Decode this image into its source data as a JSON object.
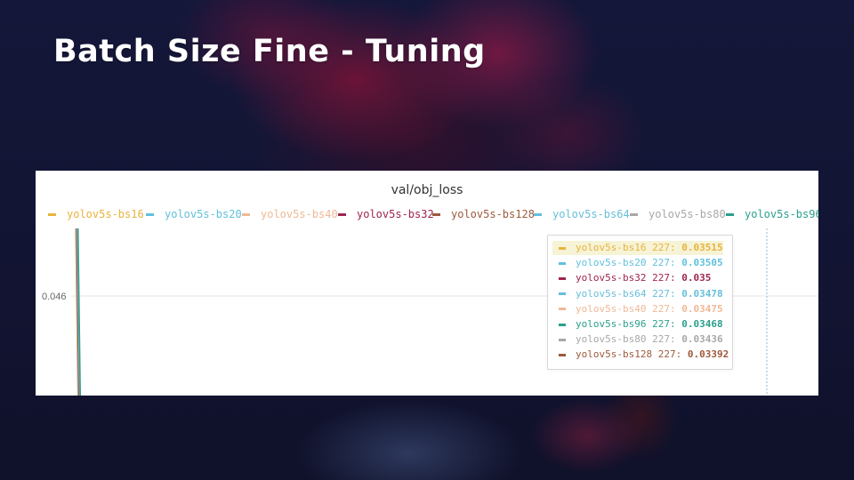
{
  "slide": {
    "title": "Batch Size Fine - Tuning"
  },
  "colors": {
    "background": "#141634",
    "panel": "#ffffff"
  },
  "chart_data": {
    "type": "line",
    "title": "val/obj_loss",
    "xlabel": "",
    "ylabel": "",
    "y_ticks": [
      "0.046"
    ],
    "legend_placement": "top",
    "grid": true,
    "series": [
      {
        "name": "yolov5s-bs16",
        "color": "#e8b33c",
        "final_epoch": 227,
        "final_value": 0.03515
      },
      {
        "name": "yolov5s-bs20",
        "color": "#61c0dd",
        "final_epoch": 227,
        "final_value": 0.03505
      },
      {
        "name": "yolov5s-bs40",
        "color": "#f0b896",
        "final_epoch": 227,
        "final_value": 0.03475
      },
      {
        "name": "yolov5s-bs32",
        "color": "#a0244f",
        "final_epoch": 227,
        "final_value": 0.035
      },
      {
        "name": "yolov5s-bs128",
        "color": "#9c5a3c",
        "final_epoch": 227,
        "final_value": 0.03392
      },
      {
        "name": "yolov5s-bs64",
        "color": "#66bfd9",
        "final_epoch": 227,
        "final_value": 0.03478
      },
      {
        "name": "yolov5s-bs80",
        "color": "#a8a8a8",
        "final_epoch": 227,
        "final_value": 0.03436
      },
      {
        "name": "yolov5s-bs96",
        "color": "#2a9f8c",
        "final_epoch": 227,
        "final_value": 0.03468
      }
    ],
    "tooltip": {
      "epoch": 227,
      "highlighted": "yolov5s-bs16",
      "rows": [
        {
          "series": "yolov5s-bs16",
          "label": "yolov5s-bs16 227:",
          "value": "0.03515",
          "color": "#e8b33c"
        },
        {
          "series": "yolov5s-bs20",
          "label": "yolov5s-bs20 227:",
          "value": "0.03505",
          "color": "#61c0dd"
        },
        {
          "series": "yolov5s-bs32",
          "label": "yolov5s-bs32 227:",
          "value": "0.035",
          "color": "#a0244f"
        },
        {
          "series": "yolov5s-bs64",
          "label": "yolov5s-bs64 227:",
          "value": "0.03478",
          "color": "#66bfd9"
        },
        {
          "series": "yolov5s-bs40",
          "label": "yolov5s-bs40 227:",
          "value": "0.03475",
          "color": "#f0b896"
        },
        {
          "series": "yolov5s-bs96",
          "label": "yolov5s-bs96 227:",
          "value": "0.03468",
          "color": "#2a9f8c"
        },
        {
          "series": "yolov5s-bs80",
          "label": "yolov5s-bs80 227:",
          "value": "0.03436",
          "color": "#a8a8a8"
        },
        {
          "series": "yolov5s-bs128",
          "label": "yolov5s-bs128 227:",
          "value": "0.03392",
          "color": "#9c5a3c"
        }
      ]
    }
  }
}
